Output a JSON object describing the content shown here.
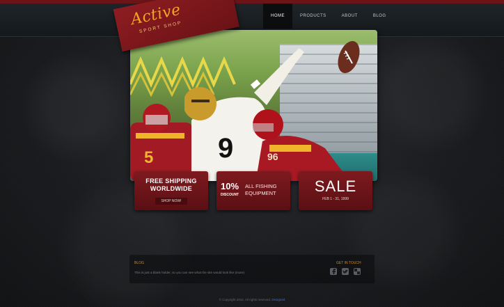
{
  "logo": {
    "title": "Active",
    "tagline": "SPORT SHOP"
  },
  "nav": {
    "items": [
      "HOME",
      "PRODUCTS",
      "ABOUT",
      "BLOG"
    ],
    "active": "HOME"
  },
  "hero": {
    "jersey_number": "9",
    "opponent_number": "96",
    "opponent_number_2": "5"
  },
  "promos": {
    "shipping": {
      "title_line1": "FREE SHIPPING",
      "title_line2": "WORLDWIDE",
      "button": "SHOP NOW!"
    },
    "fishing": {
      "percent": "10%",
      "discount": "DISCOUNT",
      "text_line1": "ALL FISHING",
      "text_line2": "EQUIPMENT"
    },
    "sale": {
      "title": "SALE",
      "dates": "FEB 1 - 31, 1999"
    }
  },
  "blog": {
    "title": "BLOG",
    "text": "This is just a blank holder, so you can see what the site would look like (more)"
  },
  "get_in_touch": {
    "title": "GET IN TOUCH",
    "icons": [
      "facebook-icon",
      "twitter-icon",
      "delicious-icon"
    ]
  },
  "footer": {
    "text": "© Copyright 2010. All rights reserved.",
    "link": "Designed"
  },
  "colors": {
    "accent_red": "#7e1a1f",
    "logo_orange": "#f5a328",
    "heading_orange": "#d18a22"
  }
}
